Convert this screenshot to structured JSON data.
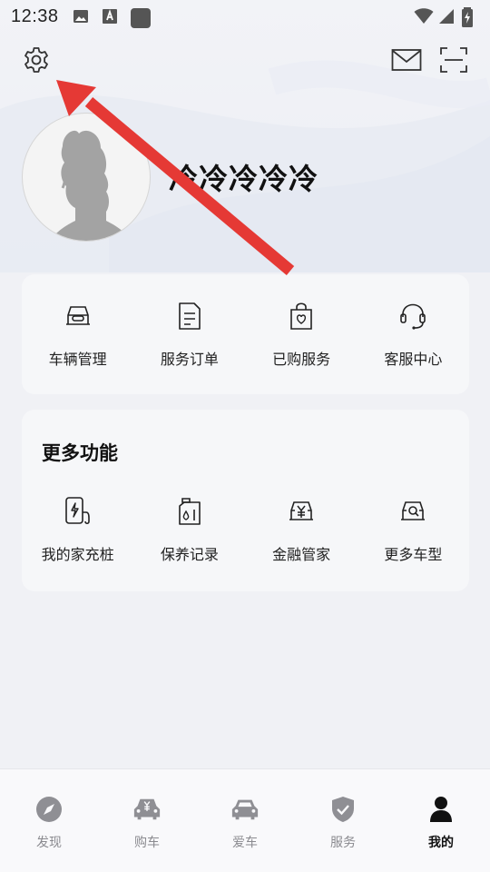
{
  "status_bar": {
    "time": "12:38",
    "left_icons": [
      "image-icon",
      "font-icon",
      "app-square-icon"
    ],
    "right_icons": [
      "wifi-icon",
      "signal-icon",
      "battery-charging-icon"
    ]
  },
  "header": {
    "settings_icon": "gear-icon",
    "mail_icon": "mail-icon",
    "scan_icon": "scan-icon"
  },
  "profile": {
    "username": "冷冷冷冷冷"
  },
  "services": [
    {
      "label": "车辆管理",
      "icon": "car-front-icon"
    },
    {
      "label": "服务订单",
      "icon": "document-icon"
    },
    {
      "label": "已购服务",
      "icon": "shopping-bag-icon"
    },
    {
      "label": "客服中心",
      "icon": "headset-icon"
    }
  ],
  "more": {
    "title": "更多功能",
    "items": [
      {
        "label": "我的家充桩",
        "icon": "charger-icon"
      },
      {
        "label": "保养记录",
        "icon": "oil-can-icon"
      },
      {
        "label": "金融管家",
        "icon": "car-yuan-icon"
      },
      {
        "label": "更多车型",
        "icon": "car-search-icon"
      }
    ]
  },
  "bottom_nav": [
    {
      "label": "发现",
      "icon": "compass-icon",
      "active": false
    },
    {
      "label": "购车",
      "icon": "car-buy-icon",
      "active": false
    },
    {
      "label": "爱车",
      "icon": "car-icon",
      "active": false
    },
    {
      "label": "服务",
      "icon": "shield-check-icon",
      "active": false
    },
    {
      "label": "我的",
      "icon": "person-icon",
      "active": true
    }
  ],
  "colors": {
    "annotation_arrow": "#e53935",
    "background": "#f0f1f5",
    "card": "#f6f7f9",
    "nav_inactive": "#8a8a8f",
    "nav_active": "#111111"
  }
}
